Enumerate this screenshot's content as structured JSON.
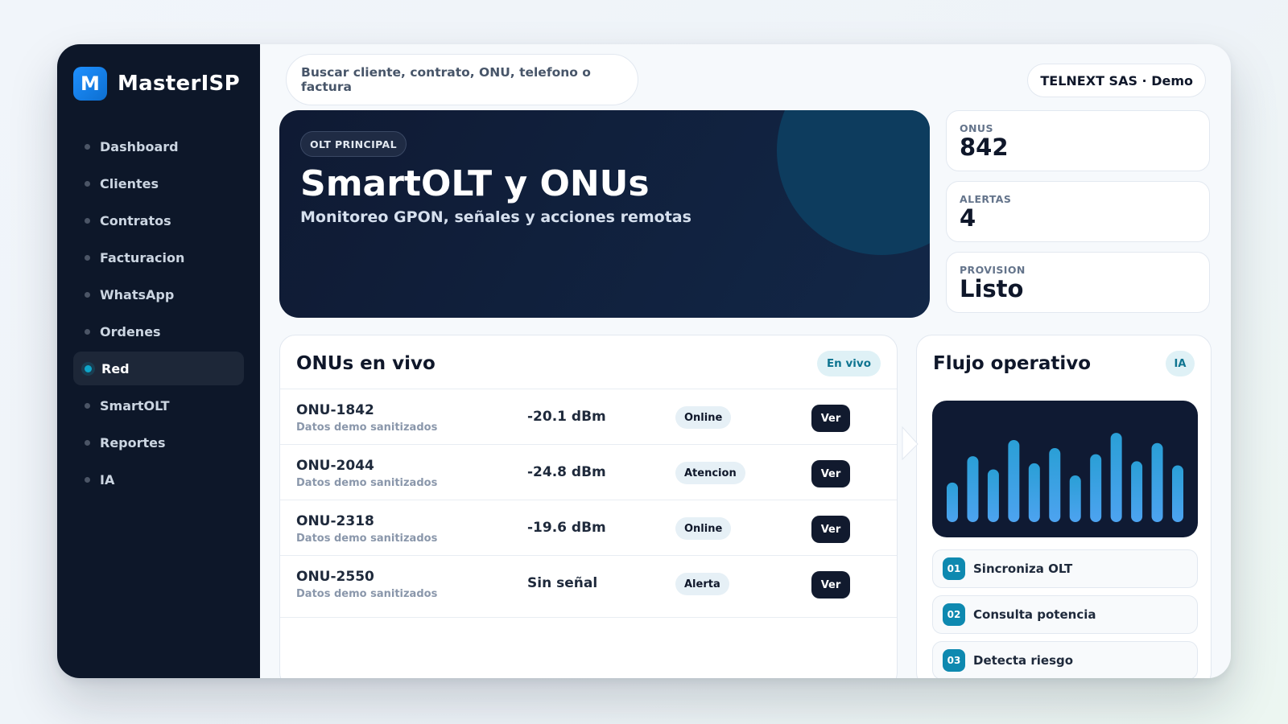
{
  "brand": {
    "logo_letter": "M",
    "name": "MasterISP"
  },
  "sidebar": {
    "items": [
      {
        "label": "Dashboard",
        "active": false
      },
      {
        "label": "Clientes",
        "active": false
      },
      {
        "label": "Contratos",
        "active": false
      },
      {
        "label": "Facturacion",
        "active": false
      },
      {
        "label": "WhatsApp",
        "active": false
      },
      {
        "label": "Ordenes",
        "active": false
      },
      {
        "label": "Red",
        "active": true
      },
      {
        "label": "SmartOLT",
        "active": false
      },
      {
        "label": "Reportes",
        "active": false
      },
      {
        "label": "IA",
        "active": false
      }
    ]
  },
  "header": {
    "search_placeholder": "Buscar cliente, contrato, ONU, telefono o factura",
    "org": "TELNEXT SAS · Demo"
  },
  "hero": {
    "tag": "OLT PRINCIPAL",
    "title": "SmartOLT y ONUs",
    "subtitle": "Monitoreo GPON, señales y acciones remotas"
  },
  "stats": [
    {
      "label": "ONUS",
      "value": "842"
    },
    {
      "label": "ALERTAS",
      "value": "4"
    },
    {
      "label": "PROVISION",
      "value": "Listo"
    }
  ],
  "onus": {
    "title": "ONUs en vivo",
    "badge": "En vivo",
    "rows": [
      {
        "name": "ONU-1842",
        "desc": "Datos demo sanitizados",
        "signal": "-20.1 dBm",
        "status": "Online",
        "action": "Ver"
      },
      {
        "name": "ONU-2044",
        "desc": "Datos demo sanitizados",
        "signal": "-24.8 dBm",
        "status": "Atencion",
        "action": "Ver"
      },
      {
        "name": "ONU-2318",
        "desc": "Datos demo sanitizados",
        "signal": "-19.6 dBm",
        "status": "Online",
        "action": "Ver"
      },
      {
        "name": "ONU-2550",
        "desc": "Datos demo sanitizados",
        "signal": "Sin señal",
        "status": "Alerta",
        "action": "Ver"
      }
    ]
  },
  "flow": {
    "title": "Flujo operativo",
    "badge": "IA",
    "bars": [
      0.39,
      0.65,
      0.52,
      0.81,
      0.58,
      0.73,
      0.46,
      0.67,
      0.88,
      0.6,
      0.78,
      0.56
    ],
    "bar_color_top": "#2a9fd6",
    "bar_color_bottom": "#4da3f0",
    "steps": [
      {
        "num": "01",
        "label": "Sincroniza OLT"
      },
      {
        "num": "02",
        "label": "Consulta potencia"
      },
      {
        "num": "03",
        "label": "Detecta riesgo"
      }
    ]
  },
  "colors": {
    "sidebar_bg": "#0d1729",
    "accent": "#0ea5c9",
    "hero_bg": "#0f1a33",
    "button_dark": "#111a2e"
  }
}
